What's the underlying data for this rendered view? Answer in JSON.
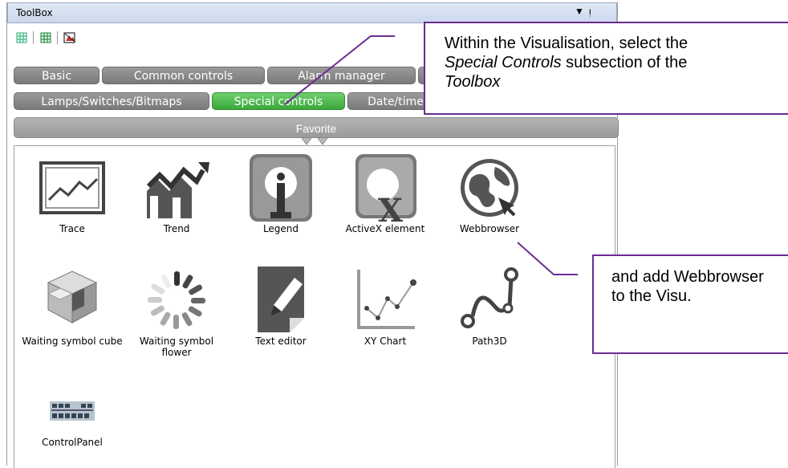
{
  "toolbox": {
    "title": "ToolBox",
    "pin_glyph": "▼",
    "close_glyph": "ᴉ",
    "tabs_row1": [
      "Basic",
      "Common controls",
      "Alarm manager"
    ],
    "tabs_row2": [
      "Lamps/Switches/Bitmaps",
      "Special controls",
      "Date/time"
    ],
    "favorite_label": "Favorite",
    "items": [
      {
        "label": "Trace",
        "icon": "trace-icon"
      },
      {
        "label": "Trend",
        "icon": "trend-icon"
      },
      {
        "label": "Legend",
        "icon": "legend-icon"
      },
      {
        "label": "ActiveX element",
        "icon": "activex-icon"
      },
      {
        "label": "Webbrowser",
        "icon": "webbrowser-icon"
      },
      {
        "label": "Waiting symbol cube",
        "icon": "waiting-cube-icon"
      },
      {
        "label": "Waiting symbol flower",
        "icon": "waiting-flower-icon"
      },
      {
        "label": "Text editor",
        "icon": "text-editor-icon"
      },
      {
        "label": "XY Chart",
        "icon": "xy-chart-icon"
      },
      {
        "label": "Path3D",
        "icon": "path3d-icon"
      },
      {
        "label": "ControlPanel",
        "icon": "control-panel-icon"
      }
    ]
  },
  "callouts": {
    "top": {
      "line1": "Within the Visualisation, select the",
      "line2_em": "Special Controls",
      "line2_rest": " subsection of the",
      "line3_em": "Toolbox"
    },
    "right": {
      "text": "and add Webbrowser to the Visu."
    }
  },
  "colors": {
    "accent": "#6a2c91",
    "active_tab": "#3aa83a",
    "tab": "#8a8a8a"
  }
}
